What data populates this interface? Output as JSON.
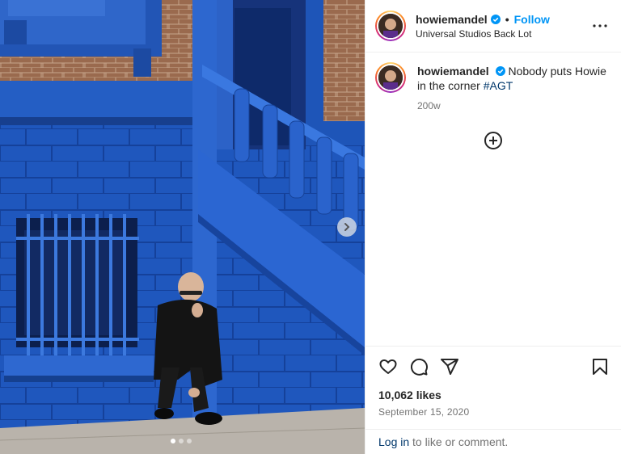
{
  "post": {
    "username": "howiemandel",
    "separator": "•",
    "follow_label": "Follow",
    "location": "Universal Studios Back Lot",
    "more_icon": "more-horizontal-icon"
  },
  "caption": {
    "username": "howiemandel",
    "text": "Nobody puts Howie in the corner",
    "hashtag": "#AGT",
    "age": "200w"
  },
  "load_more_icon": "plus-circle-icon",
  "actions": {
    "like_icon": "heart-icon",
    "comment_icon": "comment-icon",
    "share_icon": "paper-plane-icon",
    "save_icon": "bookmark-icon"
  },
  "likes_text": "10,062 likes",
  "date_text": "September 15, 2020",
  "login": {
    "link": "Log in",
    "rest": " to like or comment."
  },
  "carousel": {
    "slide_count": 3,
    "active_index": 0
  },
  "colors": {
    "accent": "#0095f6",
    "wall_blue": "#1e55b8",
    "brick": "#9a6a4e",
    "pavement": "#b9b3ab"
  }
}
